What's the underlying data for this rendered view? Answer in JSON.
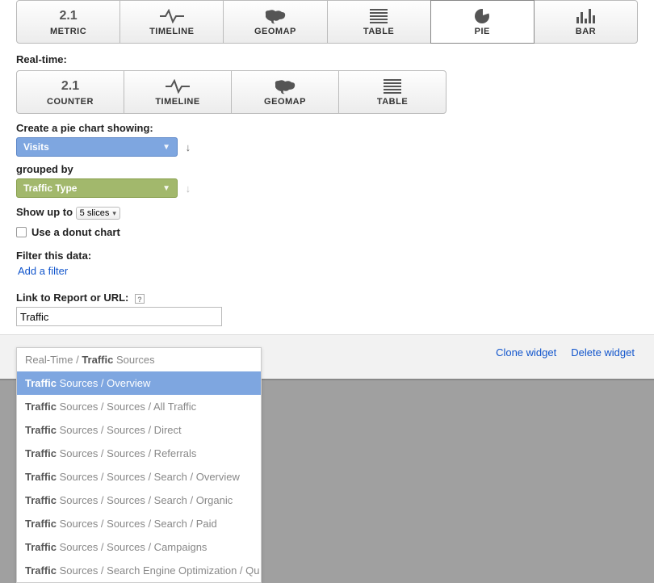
{
  "widget_types": [
    {
      "icon": "metric",
      "big": "2.1",
      "label": "METRIC"
    },
    {
      "icon": "timeline",
      "label": "TIMELINE"
    },
    {
      "icon": "geomap",
      "label": "GEOMAP"
    },
    {
      "icon": "table",
      "label": "TABLE"
    },
    {
      "icon": "pie",
      "label": "PIE",
      "selected": true
    },
    {
      "icon": "bar",
      "label": "BAR"
    }
  ],
  "realtime_label": "Real-time:",
  "realtime_types": [
    {
      "icon": "metric",
      "big": "2.1",
      "label": "COUNTER"
    },
    {
      "icon": "timeline",
      "label": "TIMELINE"
    },
    {
      "icon": "geomap",
      "label": "GEOMAP"
    },
    {
      "icon": "table",
      "label": "TABLE"
    }
  ],
  "form": {
    "create_label": "Create a pie chart showing:",
    "metric_value": "Visits",
    "grouped_label": "grouped by",
    "dimension_value": "Traffic Type",
    "showup_label": "Show up to",
    "slices_value": "5 slices",
    "donut_label": "Use a donut chart",
    "filter_label": "Filter this data:",
    "filter_link": "Add a filter",
    "url_label": "Link to Report or URL:",
    "url_value": "Traffic"
  },
  "autocomplete": {
    "query": "Traffic",
    "items": [
      {
        "pre": "Real-Time / ",
        "match": "Traffic",
        "post": " Sources"
      },
      {
        "pre": "",
        "match": "Traffic",
        "post": " Sources / Overview",
        "selected": true
      },
      {
        "pre": "",
        "match": "Traffic",
        "post": " Sources / Sources / All Traffic"
      },
      {
        "pre": "",
        "match": "Traffic",
        "post": " Sources / Sources / Direct"
      },
      {
        "pre": "",
        "match": "Traffic",
        "post": " Sources / Sources / Referrals"
      },
      {
        "pre": "",
        "match": "Traffic",
        "post": " Sources / Sources / Search / Overview"
      },
      {
        "pre": "",
        "match": "Traffic",
        "post": " Sources / Sources / Search / Organic"
      },
      {
        "pre": "",
        "match": "Traffic",
        "post": " Sources / Sources / Search / Paid"
      },
      {
        "pre": "",
        "match": "Traffic",
        "post": " Sources / Sources / Campaigns"
      },
      {
        "pre": "",
        "match": "Traffic",
        "post": " Sources / Search Engine Optimization / Qu"
      }
    ]
  },
  "footer": {
    "clone": "Clone widget",
    "delete": "Delete widget"
  }
}
